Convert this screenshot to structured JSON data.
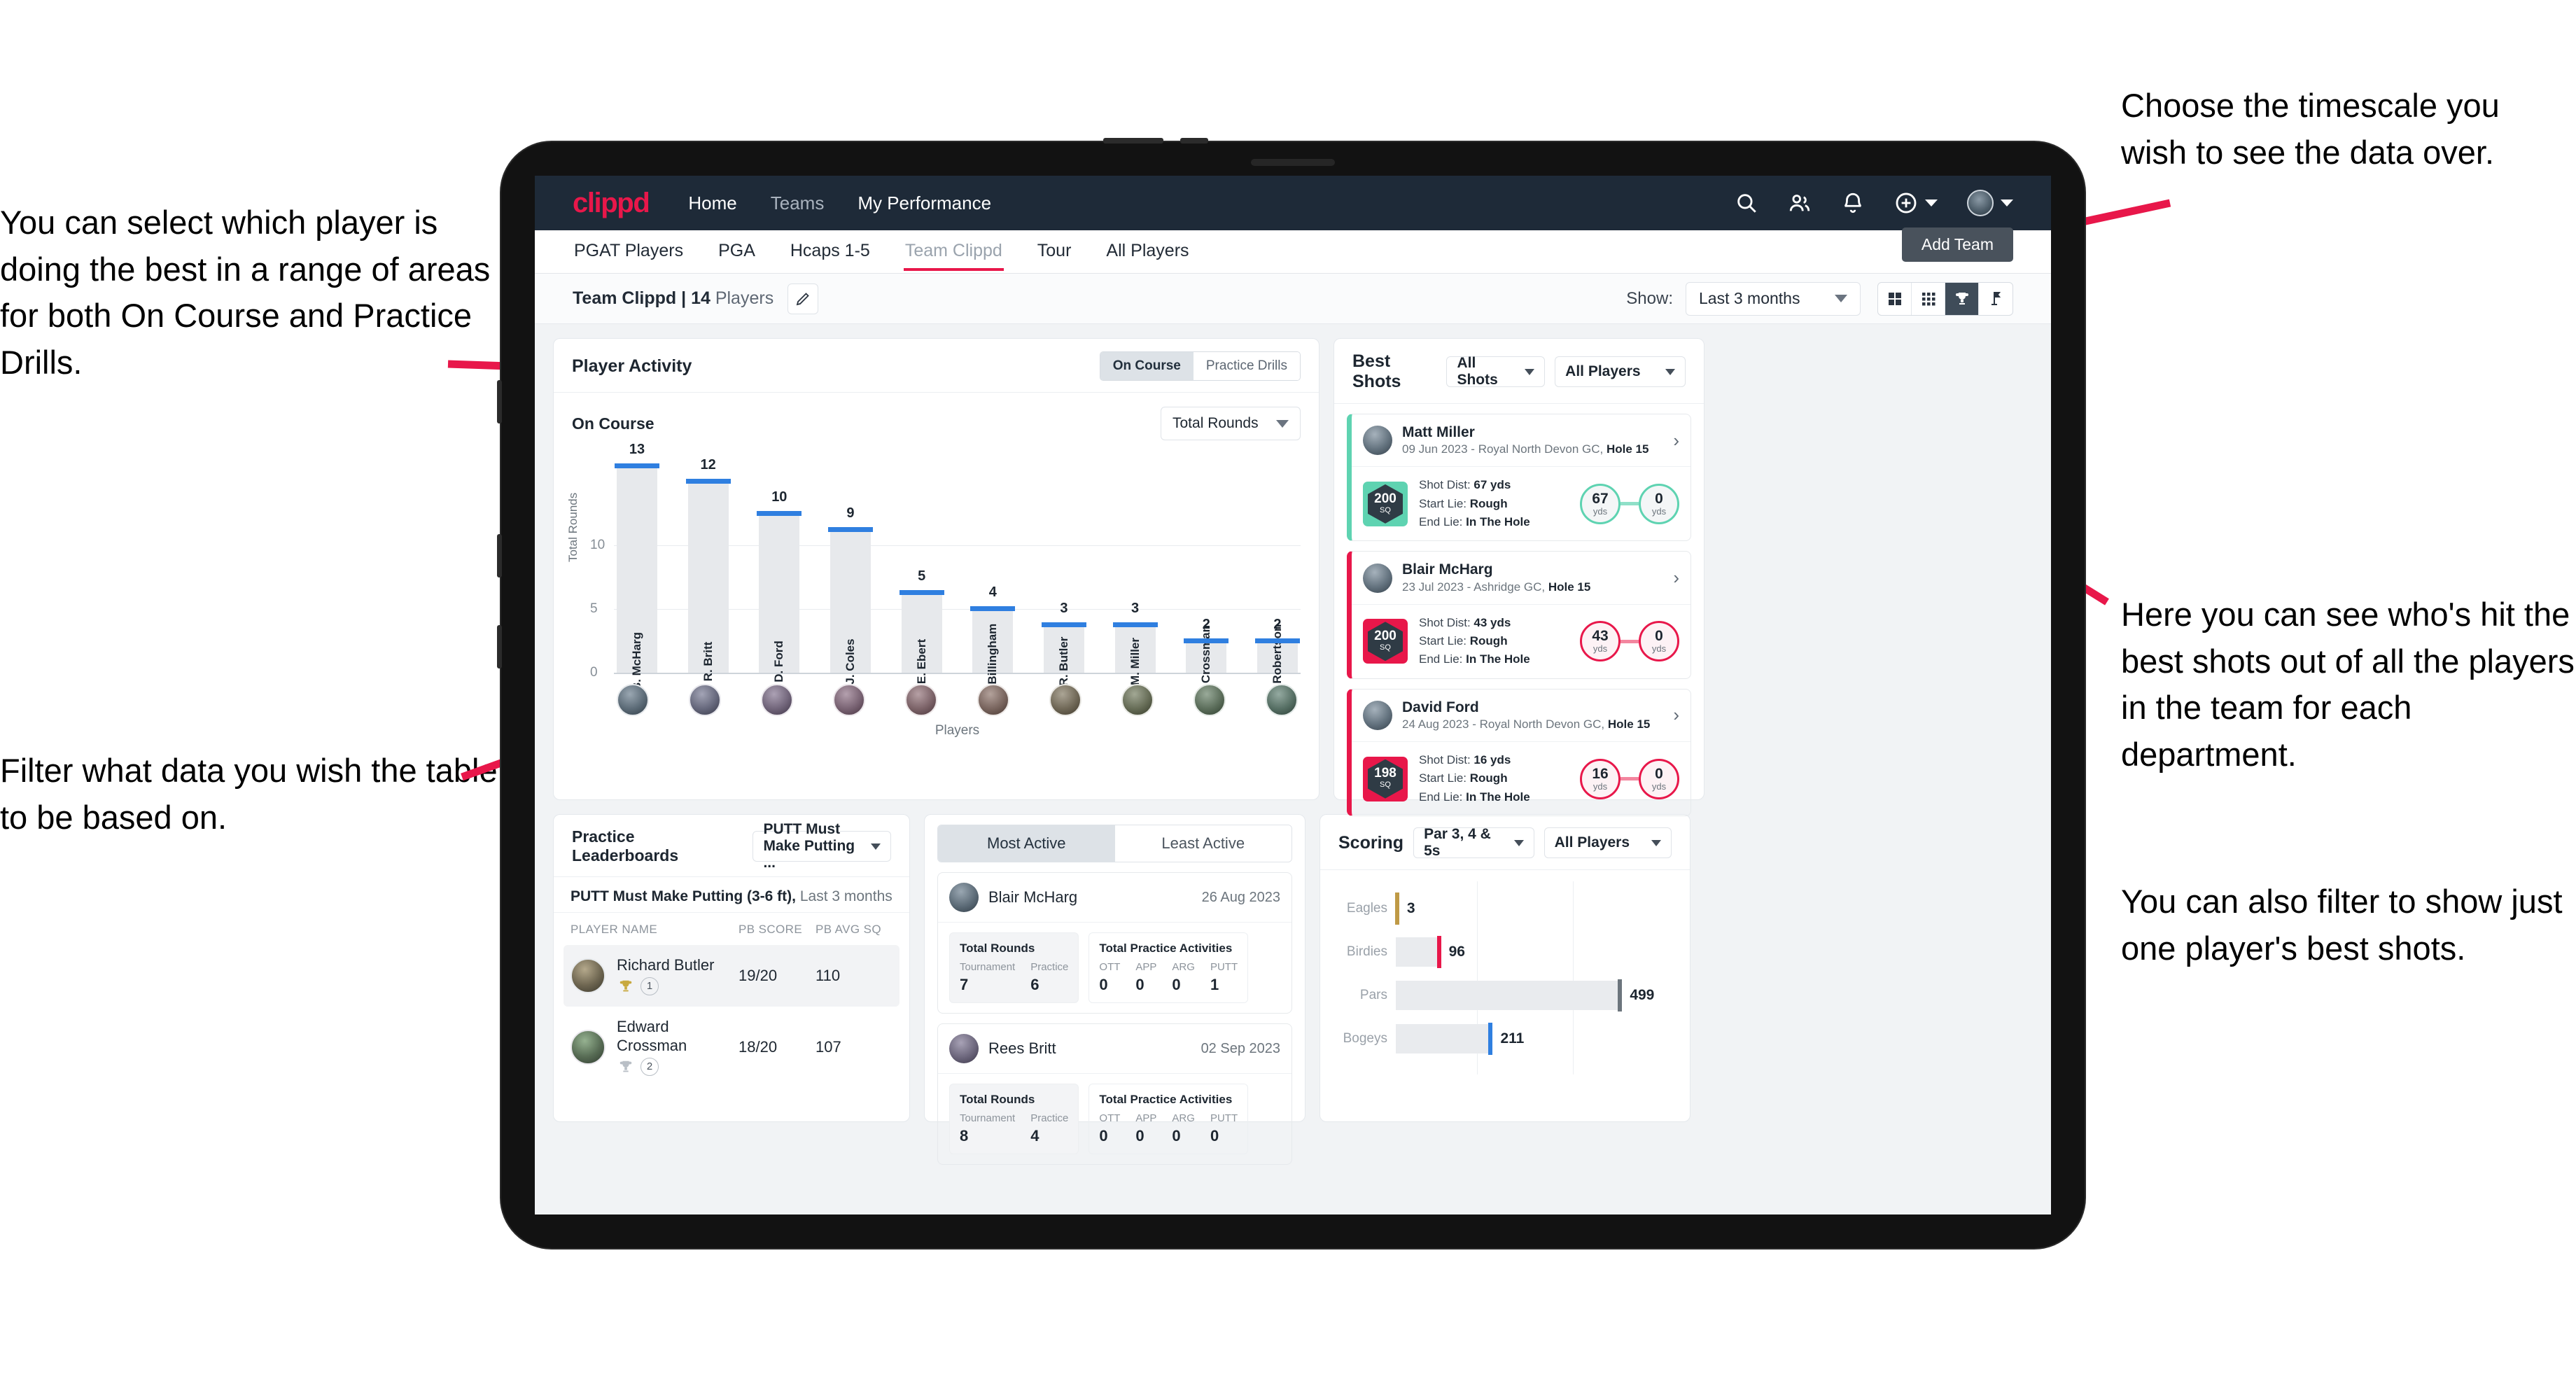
{
  "annotations": {
    "left_top": "You can select which player is doing the best in a range of areas for both On Course and Practice Drills.",
    "left_bottom": "Filter what data you wish the table to be based on.",
    "right_top": "Choose the timescale you wish to see the data over.",
    "right_middle": "Here you can see who's hit the best shots out of all the players in the team for each department.",
    "right_bottom": "You can also filter to show just one player's best shots."
  },
  "topnav": {
    "logo": "clippd",
    "links": [
      {
        "label": "Home",
        "active": true
      },
      {
        "label": "Teams",
        "active": false
      },
      {
        "label": "My Performance",
        "active": true
      }
    ],
    "icons": [
      "search-icon",
      "people-icon",
      "bell-icon",
      "plus-circle-icon",
      "avatar"
    ]
  },
  "tabs": {
    "items": [
      {
        "label": "PGAT Players"
      },
      {
        "label": "PGA"
      },
      {
        "label": "Hcaps 1-5"
      },
      {
        "label": "Team Clippd"
      },
      {
        "label": "Tour"
      },
      {
        "label": "All Players"
      }
    ],
    "active_index": 3,
    "add_team_label": "Add Team"
  },
  "subbar": {
    "team_name": "Team Clippd",
    "separator": "|",
    "player_count": "14",
    "players_word": "Players",
    "edit_icon": "pencil-icon",
    "show_label": "Show:",
    "timescale_value": "Last 3 months",
    "view_icons": [
      "grid-large-icon",
      "grid-small-icon",
      "trophy-icon",
      "flag-icon"
    ],
    "active_view_index": 2
  },
  "player_activity": {
    "title": "Player Activity",
    "segments": [
      "On Course",
      "Practice Drills"
    ],
    "active_segment": 0,
    "sub_label": "On Course",
    "metric_value": "Total Rounds"
  },
  "chart_data": [
    {
      "type": "bar",
      "title": "Player Activity",
      "categories": [
        "B. McHarg",
        "R. Britt",
        "D. Ford",
        "J. Coles",
        "E. Ebert",
        "D. Billingham",
        "R. Butler",
        "M. Miller",
        "E. Crossman",
        "C. Robertson"
      ],
      "values": [
        13,
        12,
        10,
        9,
        5,
        4,
        3,
        3,
        2,
        2
      ],
      "xlabel": "Players",
      "ylabel": "Total Rounds",
      "yticks": [
        0,
        5,
        10
      ],
      "ylim": [
        0,
        14
      ],
      "grid": true,
      "bar_color": "#e7e9ec",
      "cap_color": "#2f7fe0"
    },
    {
      "type": "bar",
      "title": "Scoring",
      "orientation": "horizontal",
      "categories": [
        "Eagles",
        "Birdies",
        "Pars",
        "Bogeys"
      ],
      "values": [
        3,
        96,
        499,
        211
      ],
      "colors": [
        "#bf9a46",
        "#e8174a",
        "#6c757d",
        "#2f7fe0"
      ],
      "xlabel": "",
      "ylabel": "",
      "xlim": [
        0,
        620
      ],
      "grid": true
    }
  ],
  "best_shots": {
    "title": "Best Shots",
    "shot_filter": "All Shots",
    "player_filter": "All Players",
    "cards": [
      {
        "name": "Matt Miller",
        "meta_date": "09 Jun 2023 - Royal North Devon GC,",
        "meta_hole": "Hole 15",
        "badge_value": "200",
        "badge_unit": "SQ",
        "accent": "teal",
        "shot_dist_label": "Shot Dist:",
        "shot_dist_value": "67 yds",
        "start_lie_label": "Start Lie:",
        "start_lie_value": "Rough",
        "end_lie_label": "End Lie:",
        "end_lie_value": "In The Hole",
        "from_value": "67",
        "from_unit": "yds",
        "to_value": "0",
        "to_unit": "yds"
      },
      {
        "name": "Blair McHarg",
        "meta_date": "23 Jul 2023 - Ashridge GC,",
        "meta_hole": "Hole 15",
        "badge_value": "200",
        "badge_unit": "SQ",
        "accent": "pink",
        "shot_dist_label": "Shot Dist:",
        "shot_dist_value": "43 yds",
        "start_lie_label": "Start Lie:",
        "start_lie_value": "Rough",
        "end_lie_label": "End Lie:",
        "end_lie_value": "In The Hole",
        "from_value": "43",
        "from_unit": "yds",
        "to_value": "0",
        "to_unit": "yds"
      },
      {
        "name": "David Ford",
        "meta_date": "24 Aug 2023 - Royal North Devon GC,",
        "meta_hole": "Hole 15",
        "badge_value": "198",
        "badge_unit": "SQ",
        "accent": "pink",
        "shot_dist_label": "Shot Dist:",
        "shot_dist_value": "16 yds",
        "start_lie_label": "Start Lie:",
        "start_lie_value": "Rough",
        "end_lie_label": "End Lie:",
        "end_lie_value": "In The Hole",
        "from_value": "16",
        "from_unit": "yds",
        "to_value": "0",
        "to_unit": "yds"
      }
    ]
  },
  "practice_leaderboards": {
    "title": "Practice Leaderboards",
    "drill_select": "PUTT Must Make Putting ...",
    "subtitle_bold": "PUTT Must Make Putting (3-6 ft),",
    "subtitle_rest": "Last 3 months",
    "columns": [
      "PLAYER NAME",
      "PB SCORE",
      "PB AVG SQ"
    ],
    "rows": [
      {
        "name": "Richard Butler",
        "rank": "1",
        "pb_score": "19/20",
        "pb_avg_sq": "110",
        "trophy": "gold"
      },
      {
        "name": "Edward Crossman",
        "rank": "2",
        "pb_score": "18/20",
        "pb_avg_sq": "107",
        "trophy": "silver"
      }
    ]
  },
  "activity_panel": {
    "tabs": [
      "Most Active",
      "Least Active"
    ],
    "active_tab": 0,
    "rounds_title": "Total Rounds",
    "rounds_cols": [
      "Tournament",
      "Practice"
    ],
    "practice_title": "Total Practice Activities",
    "practice_cols": [
      "OTT",
      "APP",
      "ARG",
      "PUTT"
    ],
    "cards": [
      {
        "name": "Blair McHarg",
        "date": "26 Aug 2023",
        "tournament": "7",
        "practice": "6",
        "ott": "0",
        "app": "0",
        "arg": "0",
        "putt": "1"
      },
      {
        "name": "Rees Britt",
        "date": "02 Sep 2023",
        "tournament": "8",
        "practice": "4",
        "ott": "0",
        "app": "0",
        "arg": "0",
        "putt": "0"
      }
    ]
  },
  "scoring": {
    "title": "Scoring",
    "par_filter": "Par 3, 4 & 5s",
    "player_filter": "All Players",
    "rows": [
      {
        "label": "Eagles",
        "value": "3",
        "color": "#bf9a46"
      },
      {
        "label": "Birdies",
        "value": "96",
        "color": "#e8174a"
      },
      {
        "label": "Pars",
        "value": "499",
        "color": "#6c757d"
      },
      {
        "label": "Bogeys",
        "value": "211",
        "color": "#2f7fe0"
      }
    ]
  },
  "colors": {
    "brand_pink": "#e8174a",
    "nav_dark": "#1e2a38",
    "bar_cap_blue": "#2f7fe0",
    "teal": "#5ed3b1"
  }
}
